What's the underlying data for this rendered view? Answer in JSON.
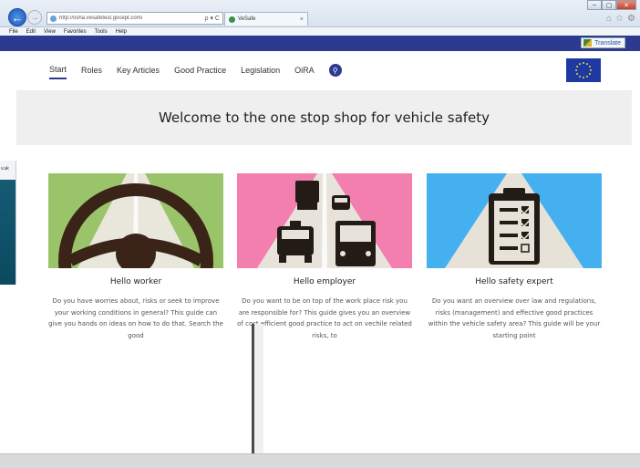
{
  "browser": {
    "url": "http://osha.vesafetest.gocept.com/",
    "tab_title": "VeSafe",
    "address_controls": "ρ ▾ C",
    "tab_close": "×",
    "window_buttons": [
      "–",
      "▢",
      "✕"
    ],
    "tool_icons": [
      "home-icon",
      "star-icon",
      "gear-icon"
    ]
  },
  "menubar": {
    "items": [
      "File",
      "Edit",
      "View",
      "Favorites",
      "Tools",
      "Help"
    ]
  },
  "header": {
    "translate_label": "Translate",
    "brand_color": "#2c3a8f"
  },
  "nav": {
    "items": [
      "Start",
      "Roles",
      "Key Articles",
      "Good Practice",
      "Legislation",
      "OiRA"
    ],
    "active": "Start",
    "search_icon": "⚲"
  },
  "banner": {
    "title": "Welcome to the one stop shop for vehicle safety"
  },
  "side_window": {
    "url_fragment": "v.uk"
  },
  "cards": [
    {
      "title": "Hello worker",
      "text": "Do you have worries about, risks or seek to improve your working conditions in general? This guide can give you hands on ideas on how to do that. Search the good",
      "image": "steering-wheel-icon",
      "bg_color": "#9ac46a"
    },
    {
      "title": "Hello employer",
      "text": "Do you want to be on top of the work place risk you are responsible for? This guide gives you an overview of cost efficient good practice to act on vechile related risks, to",
      "image": "traffic-vehicles-icon",
      "bg_color": "#f27fae"
    },
    {
      "title": "Hello safety expert",
      "text": "Do you want an overview over law and regulations, risks (management) and effective good practices within the vehicle safety area? This guide will be your starting point",
      "image": "checklist-clipboard-icon",
      "bg_color": "#45b0f0"
    }
  ]
}
